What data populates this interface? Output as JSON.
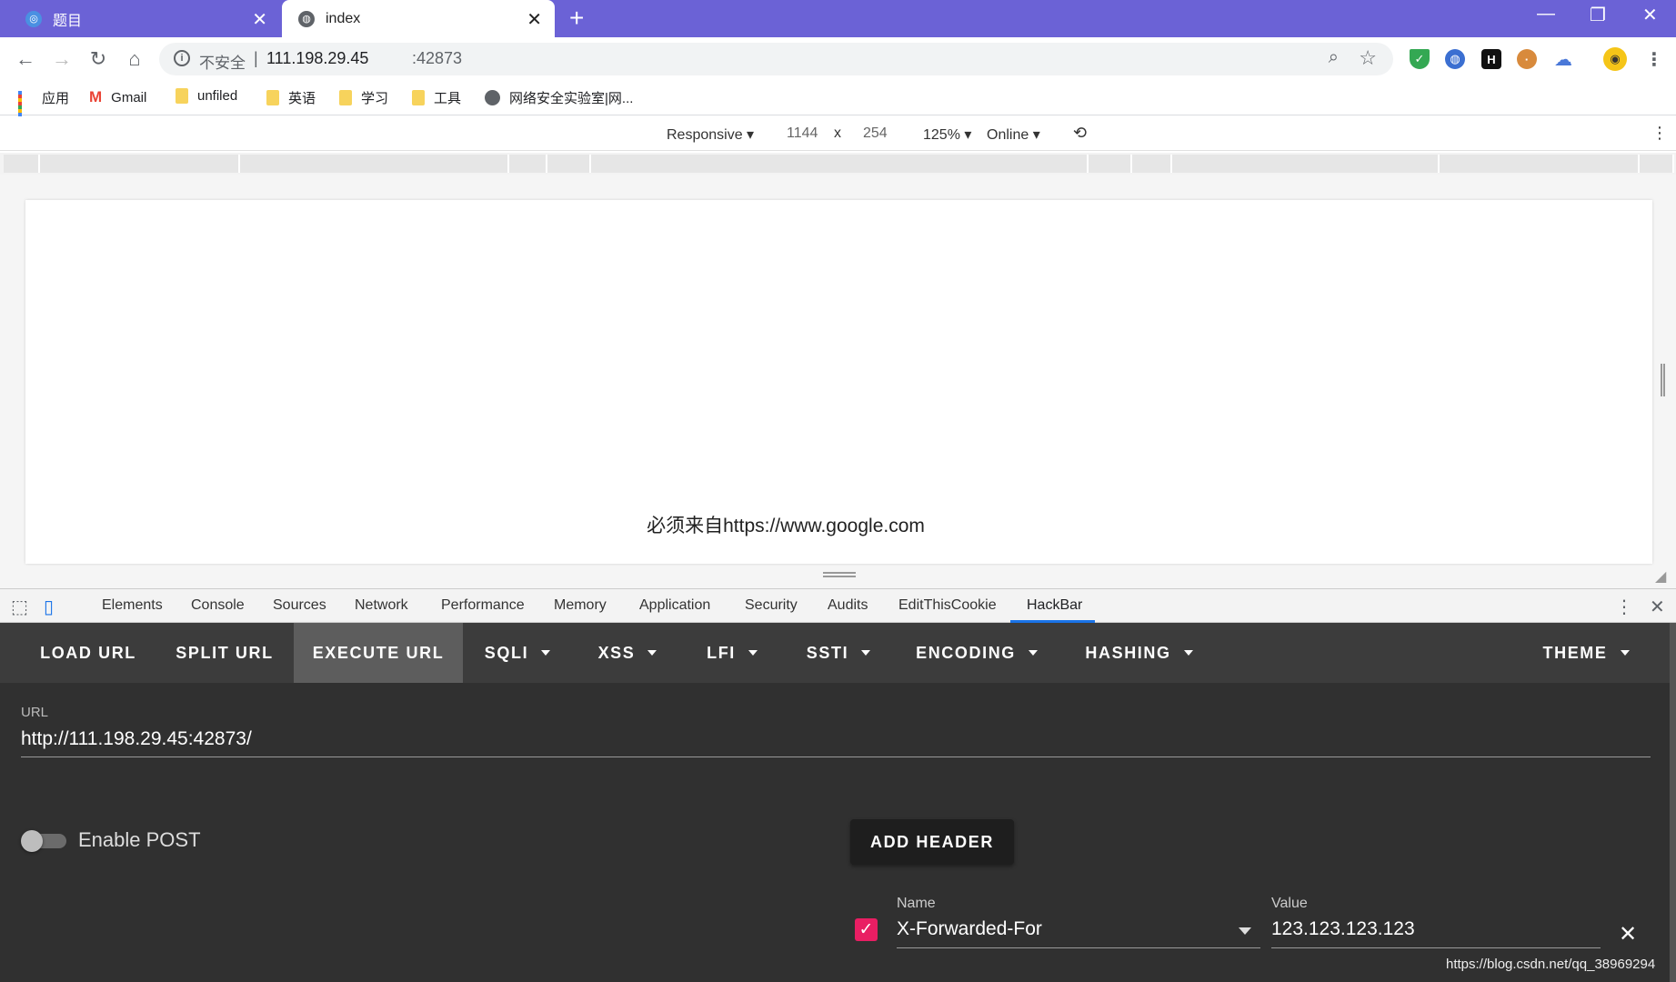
{
  "tabs": [
    {
      "title": "题目",
      "active": false
    },
    {
      "title": "index",
      "active": true
    }
  ],
  "address": {
    "insecure_label": "不安全",
    "separator": "|",
    "host": "111.198.29.45",
    "port": ":42873"
  },
  "bookmarks": [
    {
      "label": "应用",
      "icon": "apps-grid-icon"
    },
    {
      "label": "Gmail",
      "icon": "gmail-icon"
    },
    {
      "label": "unfiled",
      "icon": "folder-icon"
    },
    {
      "label": "英语",
      "icon": "folder-icon"
    },
    {
      "label": "学习",
      "icon": "folder-icon"
    },
    {
      "label": "工具",
      "icon": "folder-icon"
    },
    {
      "label": "网络安全实验室|网...",
      "icon": "globe-icon"
    }
  ],
  "device_toolbar": {
    "mode": "Responsive",
    "width": "1144",
    "times": "x",
    "height": "254",
    "zoom": "125%",
    "network": "Online"
  },
  "page": {
    "message": "必须来自https://www.google.com"
  },
  "devtools": {
    "tabs": [
      "Elements",
      "Console",
      "Sources",
      "Network",
      "Performance",
      "Memory",
      "Application",
      "Security",
      "Audits",
      "EditThisCookie",
      "HackBar"
    ],
    "active_tab": "HackBar"
  },
  "hackbar": {
    "menu": [
      "LOAD URL",
      "SPLIT URL",
      "EXECUTE URL",
      "SQLI",
      "XSS",
      "LFI",
      "SSTI",
      "ENCODING",
      "HASHING",
      "THEME"
    ],
    "selected": "EXECUTE URL",
    "url_label": "URL",
    "url_value": "http://111.198.29.45:42873/",
    "enable_post_label": "Enable POST",
    "enable_post": false,
    "add_header_label": "ADD HEADER",
    "header": {
      "enabled": true,
      "name_label": "Name",
      "name_value": "X-Forwarded-For",
      "value_label": "Value",
      "value_value": "123.123.123.123"
    }
  },
  "watermark": "https://blog.csdn.net/qq_38969294",
  "colors": {
    "tabstrip": "#6b62d6",
    "hackbar_bg": "#303030",
    "hackbar_menu": "#3c3c3c",
    "checkbox": "#e91e63",
    "active_tab_underline": "#1a73e8"
  }
}
